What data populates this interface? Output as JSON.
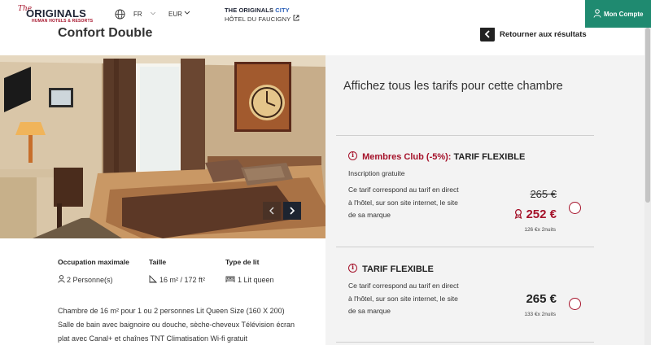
{
  "header": {
    "logo_the": "The",
    "logo_main": "ORIGINALS",
    "logo_sub": "HUMAN HOTELS & RESORTS",
    "language": "FR",
    "currency": "EUR",
    "brand_prefix": "THE ORIGINALS",
    "brand_city": "CITY",
    "hotel_name": "HÔTEL DU FAUCIGNY",
    "account_label": "Mon Compte"
  },
  "room": {
    "title": "Confort Double",
    "back_label": "Retourner aux résultats",
    "specs": [
      {
        "label": "Occupation maximale",
        "value": "2 Personne(s)",
        "icon": "person-icon"
      },
      {
        "label": "Taille",
        "value": "16 m² / 172 ft²",
        "icon": "area-icon"
      },
      {
        "label": "Type de lit",
        "value": "1 Lit queen",
        "icon": "bed-icon"
      }
    ],
    "description": "Chambre de 16 m² pour 1 ou 2 personnes Lit Queen Size (160 X 200) Salle de bain avec baignoire ou douche, sèche-cheveux Télévision écran plat avec Canal+ et chaînes TNT Climatisation Wi-fi gratuit"
  },
  "rates_panel": {
    "heading": "Affichez tous les tarifs pour cette chambre",
    "rates": [
      {
        "title_prefix": "Membres Club (-5%):",
        "title": "TARIF FLEXIBLE",
        "note": "Inscription gratuite",
        "description": "Ce tarif correspond au tarif en direct à l'hôtel, sur son site internet, le site de sa marque",
        "old_price": "265 €",
        "price": "252 €",
        "per_night": "126 €x 2nuits"
      },
      {
        "title": "TARIF FLEXIBLE",
        "description": "Ce tarif correspond au tarif en direct à l'hôtel, sur son site internet, le site de sa marque",
        "price": "265 €",
        "per_night": "133 €x 2nuits"
      }
    ]
  },
  "colors": {
    "brand_red": "#a5122a",
    "account_green": "#1f8a70",
    "panel_bg": "#f3f3f3"
  }
}
